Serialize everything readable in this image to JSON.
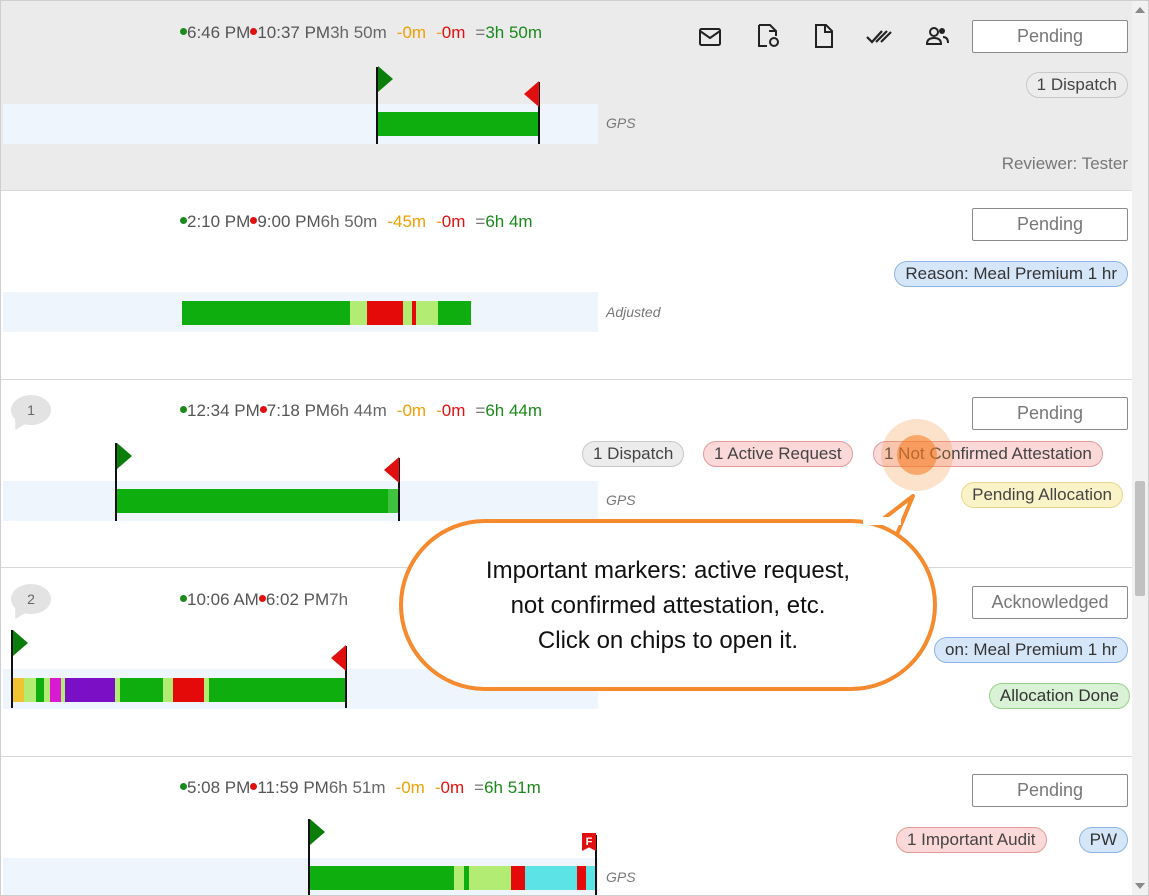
{
  "rows": [
    {
      "start": "6:46 PM",
      "end": "10:37 PM",
      "duration": "3h 50m",
      "deduct1": "0m",
      "deduct2": "0m",
      "total": "3h 50m",
      "track_label": "GPS",
      "status": "Pending",
      "chips": [
        "1 Dispatch"
      ],
      "reviewer": "Reviewer: Tester"
    },
    {
      "start": "2:10 PM",
      "end": "9:00 PM",
      "duration": "6h 50m",
      "deduct1": "45m",
      "deduct2": "0m",
      "total": "6h 4m",
      "track_label": "Adjusted",
      "status": "Pending",
      "chips": [
        "Reason: Meal Premium 1 hr"
      ]
    },
    {
      "comment_count": "1",
      "start": "12:34 PM",
      "end": "7:18 PM",
      "duration": "6h 44m",
      "deduct1": "0m",
      "deduct2": "0m",
      "total": "6h 44m",
      "track_label": "GPS",
      "status": "Pending",
      "chips": [
        "1 Dispatch",
        "1 Active Request",
        "1 Not Confirmed Attestation",
        "Pending Allocation"
      ]
    },
    {
      "comment_count": "2",
      "start": "10:06 AM",
      "end": "6:02 PM",
      "duration_partial": "7h",
      "status": "Acknowledged",
      "chips": [
        "on: Meal Premium 1 hr",
        "Allocation Done"
      ]
    },
    {
      "start": "5:08 PM",
      "end": "11:59 PM",
      "duration": "6h 51m",
      "deduct1": "0m",
      "deduct2": "0m",
      "total": "6h 51m",
      "track_label": "GPS",
      "status": "Pending",
      "chips": [
        "1 Important Audit",
        "PW"
      ],
      "flag_letter": "F"
    }
  ],
  "toolbar_icons": [
    "mail-icon",
    "document-refresh-icon",
    "document-icon",
    "double-check-icon",
    "people-icon"
  ],
  "operators": {
    "minus": "-",
    "equals": "="
  },
  "callout": {
    "line1": "Important markers: active request,",
    "line2": "not confirmed attestation, etc.",
    "line3": "Click on chips to open it."
  },
  "colors": {
    "green_bar": "#0fae0f",
    "light_green": "#b3ec72",
    "red": "#e50a0a",
    "purple": "#7b0fc6",
    "magenta": "#d81bd1",
    "yellow": "#f1c232",
    "cyan": "#5ce3e6",
    "callout_border": "#f58a2e"
  }
}
